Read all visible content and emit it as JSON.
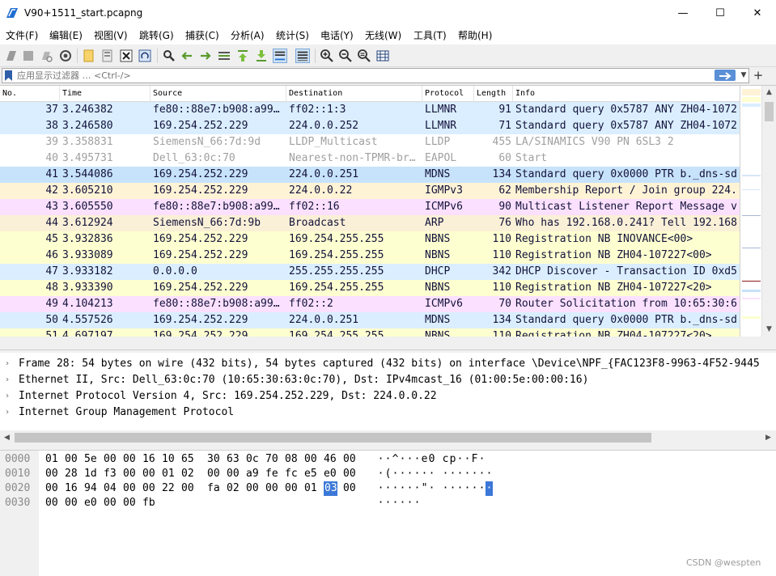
{
  "window": {
    "title": "V90+1511_start.pcapng",
    "minimize_glyph": "—",
    "maximize_glyph": "☐",
    "close_glyph": "✕"
  },
  "menu": [
    {
      "label": "文件(F)"
    },
    {
      "label": "编辑(E)"
    },
    {
      "label": "视图(V)"
    },
    {
      "label": "跳转(G)"
    },
    {
      "label": "捕获(C)"
    },
    {
      "label": "分析(A)"
    },
    {
      "label": "统计(S)"
    },
    {
      "label": "电话(Y)"
    },
    {
      "label": "无线(W)"
    },
    {
      "label": "工具(T)"
    },
    {
      "label": "帮助(H)"
    }
  ],
  "toolbar_icons": [
    "start-capture-icon",
    "stop-capture-icon",
    "restart-capture-icon",
    "capture-options-icon",
    "open-file-icon",
    "save-file-icon",
    "close-file-icon",
    "reload-file-icon",
    "find-packet-icon",
    "go-back-icon",
    "go-forward-icon",
    "go-to-packet-icon",
    "go-first-icon",
    "go-last-icon",
    "autoscroll-icon",
    "colorize-icon",
    "zoom-in-icon",
    "zoom-out-icon",
    "zoom-reset-icon",
    "resize-columns-icon"
  ],
  "filter": {
    "placeholder": "应用显示过滤器 … <Ctrl-/>",
    "value": "",
    "dropdown_glyph": "▼",
    "add_glyph": "+"
  },
  "packet_list": {
    "columns": [
      "No.",
      "Time",
      "Source",
      "Destination",
      "Protocol",
      "Length",
      "Info"
    ],
    "rows": [
      {
        "no": "37",
        "time": "3.246382",
        "src": "fe80::88e7:b908:a99…",
        "dst": "ff02::1:3",
        "proto": "LLMNR",
        "len": "91",
        "info": "Standard query 0x5787 ANY ZH04-1072",
        "bg": "#daeeff",
        "dim": false
      },
      {
        "no": "38",
        "time": "3.246580",
        "src": "169.254.252.229",
        "dst": "224.0.0.252",
        "proto": "LLMNR",
        "len": "71",
        "info": "Standard query 0x5787 ANY ZH04-1072",
        "bg": "#daeeff",
        "dim": false
      },
      {
        "no": "39",
        "time": "3.358831",
        "src": "SiemensN_66:7d:9d",
        "dst": "LLDP_Multicast",
        "proto": "LLDP",
        "len": "455",
        "info": "LA/SINAMICS V90 PN              6SL3 2",
        "bg": "#ffffff",
        "dim": true
      },
      {
        "no": "40",
        "time": "3.495731",
        "src": "Dell_63:0c:70",
        "dst": "Nearest-non-TPMR-br…",
        "proto": "EAPOL",
        "len": "60",
        "info": "Start",
        "bg": "#ffffff",
        "dim": true
      },
      {
        "no": "41",
        "time": "3.544086",
        "src": "169.254.252.229",
        "dst": "224.0.0.251",
        "proto": "MDNS",
        "len": "134",
        "info": "Standard query 0x0000 PTR b._dns-sd",
        "bg": "#c7e2fb",
        "dim": false
      },
      {
        "no": "42",
        "time": "3.605210",
        "src": "169.254.252.229",
        "dst": "224.0.0.22",
        "proto": "IGMPv3",
        "len": "62",
        "info": "Membership Report / Join group 224.",
        "bg": "#fff3d6",
        "dim": false
      },
      {
        "no": "43",
        "time": "3.605550",
        "src": "fe80::88e7:b908:a99…",
        "dst": "ff02::16",
        "proto": "ICMPv6",
        "len": "90",
        "info": "Multicast Listener Report Message v",
        "bg": "#fce0ff",
        "dim": false
      },
      {
        "no": "44",
        "time": "3.612924",
        "src": "SiemensN_66:7d:9b",
        "dst": "Broadcast",
        "proto": "ARP",
        "len": "76",
        "info": "Who has 192.168.0.241? Tell 192.168",
        "bg": "#faf0d7",
        "dim": false
      },
      {
        "no": "45",
        "time": "3.932836",
        "src": "169.254.252.229",
        "dst": "169.254.255.255",
        "proto": "NBNS",
        "len": "110",
        "info": "Registration NB INOVANCE<00>",
        "bg": "#feffd0",
        "dim": false
      },
      {
        "no": "46",
        "time": "3.933089",
        "src": "169.254.252.229",
        "dst": "169.254.255.255",
        "proto": "NBNS",
        "len": "110",
        "info": "Registration NB ZH04-107227<00>",
        "bg": "#feffd0",
        "dim": false
      },
      {
        "no": "47",
        "time": "3.933182",
        "src": "0.0.0.0",
        "dst": "255.255.255.255",
        "proto": "DHCP",
        "len": "342",
        "info": "DHCP Discover - Transaction ID 0xd5",
        "bg": "#daeeff",
        "dim": false
      },
      {
        "no": "48",
        "time": "3.933390",
        "src": "169.254.252.229",
        "dst": "169.254.255.255",
        "proto": "NBNS",
        "len": "110",
        "info": "Registration NB ZH04-107227<20>",
        "bg": "#feffd0",
        "dim": false
      },
      {
        "no": "49",
        "time": "4.104213",
        "src": "fe80::88e7:b908:a99…",
        "dst": "ff02::2",
        "proto": "ICMPv6",
        "len": "70",
        "info": "Router Solicitation from 10:65:30:6",
        "bg": "#fce0ff",
        "dim": false
      },
      {
        "no": "50",
        "time": "4.557526",
        "src": "169.254.252.229",
        "dst": "224.0.0.251",
        "proto": "MDNS",
        "len": "134",
        "info": "Standard query 0x0000 PTR b._dns-sd",
        "bg": "#daeeff",
        "dim": false
      },
      {
        "no": "51",
        "time": "4.697197",
        "src": "169.254.252.229",
        "dst": "169.254.255.255",
        "proto": "NBNS",
        "len": "110",
        "info": "Registration NB ZH04-107227<20>",
        "bg": "#feffd0",
        "dim": false
      }
    ]
  },
  "details": [
    {
      "expander": "›",
      "text": "Frame 28: 54 bytes on wire (432 bits), 54 bytes captured (432 bits) on interface \\Device\\NPF_{FAC123F8-9963-4F52-9445"
    },
    {
      "expander": "›",
      "text": "Ethernet II, Src: Dell_63:0c:70 (10:65:30:63:0c:70), Dst: IPv4mcast_16 (01:00:5e:00:00:16)"
    },
    {
      "expander": "›",
      "text": "Internet Protocol Version 4, Src: 169.254.252.229, Dst: 224.0.0.22"
    },
    {
      "expander": "›",
      "text": "Internet Group Management Protocol"
    }
  ],
  "bytes": [
    {
      "offset": "0000",
      "hex": [
        "01",
        "00",
        "5e",
        "00",
        "00",
        "16",
        "10",
        "65",
        "30",
        "63",
        "0c",
        "70",
        "08",
        "00",
        "46",
        "00"
      ],
      "ascii": [
        "·",
        "·",
        "^",
        "·",
        "·",
        "·",
        "e",
        "0",
        "c",
        "p",
        "·",
        "·",
        "F",
        "·"
      ]
    },
    {
      "offset": "0010",
      "hex": [
        "00",
        "28",
        "1d",
        "f3",
        "00",
        "00",
        "01",
        "02",
        "00",
        "00",
        "a9",
        "fe",
        "fc",
        "e5",
        "e0",
        "00"
      ],
      "ascii": [
        "·",
        "(",
        "·",
        "·",
        "·",
        "·",
        "·",
        "·",
        "·",
        "·",
        "·",
        "·",
        "·",
        "·",
        "·"
      ]
    },
    {
      "offset": "0020",
      "hex": [
        "00",
        "16",
        "94",
        "04",
        "00",
        "00",
        "22",
        "00",
        "fa",
        "02",
        "00",
        "00",
        "00",
        "01",
        "03",
        "00"
      ],
      "ascii": [
        "·",
        "·",
        "·",
        "·",
        "·",
        "·",
        "\"",
        "·",
        "·",
        "·",
        "·",
        "·",
        "·",
        "·",
        "·"
      ]
    },
    {
      "offset": "0030",
      "hex": [
        "00",
        "00",
        "e0",
        "00",
        "00",
        "fb"
      ],
      "ascii": [
        "·",
        "·",
        "·",
        "·",
        "·",
        "·"
      ]
    }
  ],
  "bytes_selection": {
    "row": 2,
    "hex_index": 14,
    "ascii_index": 14
  },
  "watermark": "CSDN @wespten",
  "colors": {
    "selection": "#3b78d8",
    "accent_blue": "#5b8fd6",
    "row_text": "#12123a"
  }
}
